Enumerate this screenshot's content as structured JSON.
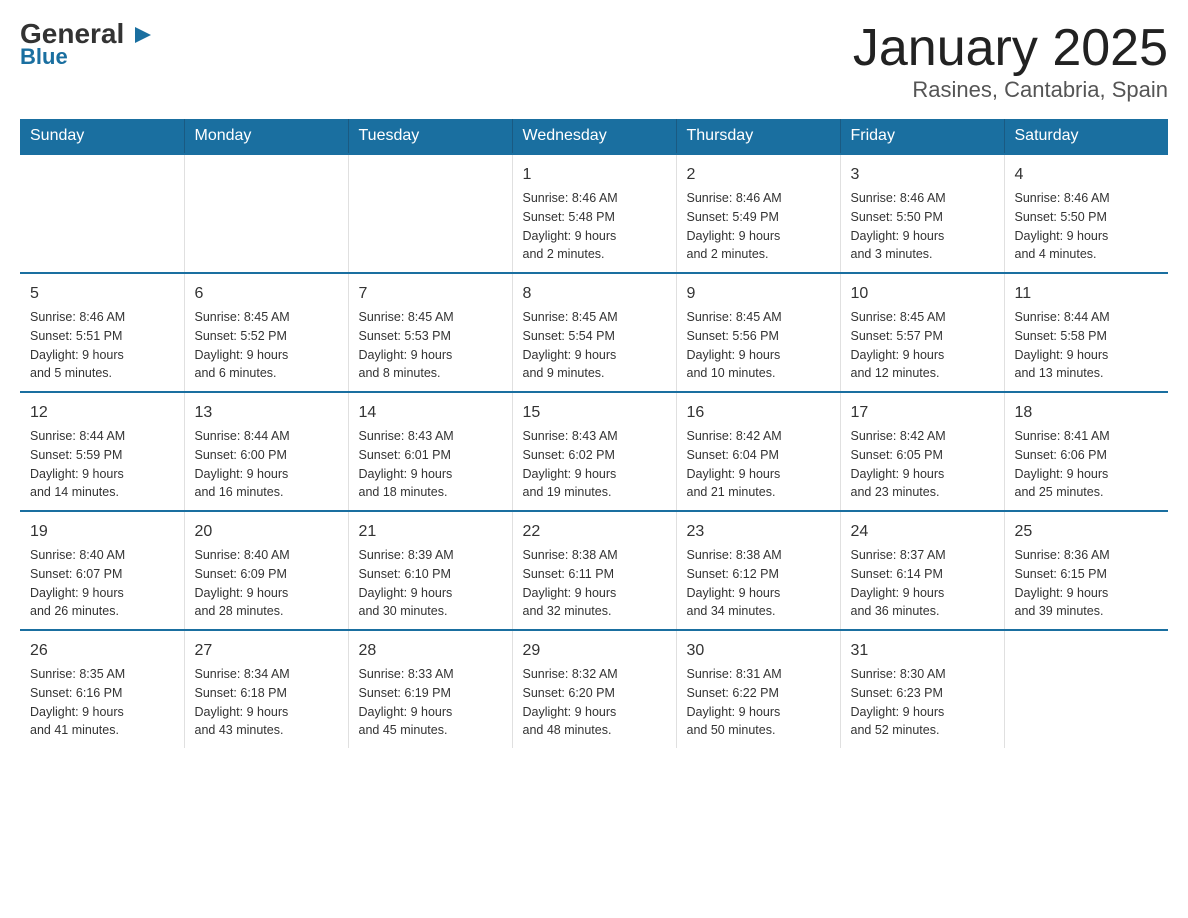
{
  "logo": {
    "line1_regular": "General",
    "line1_arrow": "▶",
    "line2": "Blue"
  },
  "title": "January 2025",
  "location": "Rasines, Cantabria, Spain",
  "days_of_week": [
    "Sunday",
    "Monday",
    "Tuesday",
    "Wednesday",
    "Thursday",
    "Friday",
    "Saturday"
  ],
  "weeks": [
    [
      {
        "day": "",
        "info": ""
      },
      {
        "day": "",
        "info": ""
      },
      {
        "day": "",
        "info": ""
      },
      {
        "day": "1",
        "info": "Sunrise: 8:46 AM\nSunset: 5:48 PM\nDaylight: 9 hours\nand 2 minutes."
      },
      {
        "day": "2",
        "info": "Sunrise: 8:46 AM\nSunset: 5:49 PM\nDaylight: 9 hours\nand 2 minutes."
      },
      {
        "day": "3",
        "info": "Sunrise: 8:46 AM\nSunset: 5:50 PM\nDaylight: 9 hours\nand 3 minutes."
      },
      {
        "day": "4",
        "info": "Sunrise: 8:46 AM\nSunset: 5:50 PM\nDaylight: 9 hours\nand 4 minutes."
      }
    ],
    [
      {
        "day": "5",
        "info": "Sunrise: 8:46 AM\nSunset: 5:51 PM\nDaylight: 9 hours\nand 5 minutes."
      },
      {
        "day": "6",
        "info": "Sunrise: 8:45 AM\nSunset: 5:52 PM\nDaylight: 9 hours\nand 6 minutes."
      },
      {
        "day": "7",
        "info": "Sunrise: 8:45 AM\nSunset: 5:53 PM\nDaylight: 9 hours\nand 8 minutes."
      },
      {
        "day": "8",
        "info": "Sunrise: 8:45 AM\nSunset: 5:54 PM\nDaylight: 9 hours\nand 9 minutes."
      },
      {
        "day": "9",
        "info": "Sunrise: 8:45 AM\nSunset: 5:56 PM\nDaylight: 9 hours\nand 10 minutes."
      },
      {
        "day": "10",
        "info": "Sunrise: 8:45 AM\nSunset: 5:57 PM\nDaylight: 9 hours\nand 12 minutes."
      },
      {
        "day": "11",
        "info": "Sunrise: 8:44 AM\nSunset: 5:58 PM\nDaylight: 9 hours\nand 13 minutes."
      }
    ],
    [
      {
        "day": "12",
        "info": "Sunrise: 8:44 AM\nSunset: 5:59 PM\nDaylight: 9 hours\nand 14 minutes."
      },
      {
        "day": "13",
        "info": "Sunrise: 8:44 AM\nSunset: 6:00 PM\nDaylight: 9 hours\nand 16 minutes."
      },
      {
        "day": "14",
        "info": "Sunrise: 8:43 AM\nSunset: 6:01 PM\nDaylight: 9 hours\nand 18 minutes."
      },
      {
        "day": "15",
        "info": "Sunrise: 8:43 AM\nSunset: 6:02 PM\nDaylight: 9 hours\nand 19 minutes."
      },
      {
        "day": "16",
        "info": "Sunrise: 8:42 AM\nSunset: 6:04 PM\nDaylight: 9 hours\nand 21 minutes."
      },
      {
        "day": "17",
        "info": "Sunrise: 8:42 AM\nSunset: 6:05 PM\nDaylight: 9 hours\nand 23 minutes."
      },
      {
        "day": "18",
        "info": "Sunrise: 8:41 AM\nSunset: 6:06 PM\nDaylight: 9 hours\nand 25 minutes."
      }
    ],
    [
      {
        "day": "19",
        "info": "Sunrise: 8:40 AM\nSunset: 6:07 PM\nDaylight: 9 hours\nand 26 minutes."
      },
      {
        "day": "20",
        "info": "Sunrise: 8:40 AM\nSunset: 6:09 PM\nDaylight: 9 hours\nand 28 minutes."
      },
      {
        "day": "21",
        "info": "Sunrise: 8:39 AM\nSunset: 6:10 PM\nDaylight: 9 hours\nand 30 minutes."
      },
      {
        "day": "22",
        "info": "Sunrise: 8:38 AM\nSunset: 6:11 PM\nDaylight: 9 hours\nand 32 minutes."
      },
      {
        "day": "23",
        "info": "Sunrise: 8:38 AM\nSunset: 6:12 PM\nDaylight: 9 hours\nand 34 minutes."
      },
      {
        "day": "24",
        "info": "Sunrise: 8:37 AM\nSunset: 6:14 PM\nDaylight: 9 hours\nand 36 minutes."
      },
      {
        "day": "25",
        "info": "Sunrise: 8:36 AM\nSunset: 6:15 PM\nDaylight: 9 hours\nand 39 minutes."
      }
    ],
    [
      {
        "day": "26",
        "info": "Sunrise: 8:35 AM\nSunset: 6:16 PM\nDaylight: 9 hours\nand 41 minutes."
      },
      {
        "day": "27",
        "info": "Sunrise: 8:34 AM\nSunset: 6:18 PM\nDaylight: 9 hours\nand 43 minutes."
      },
      {
        "day": "28",
        "info": "Sunrise: 8:33 AM\nSunset: 6:19 PM\nDaylight: 9 hours\nand 45 minutes."
      },
      {
        "day": "29",
        "info": "Sunrise: 8:32 AM\nSunset: 6:20 PM\nDaylight: 9 hours\nand 48 minutes."
      },
      {
        "day": "30",
        "info": "Sunrise: 8:31 AM\nSunset: 6:22 PM\nDaylight: 9 hours\nand 50 minutes."
      },
      {
        "day": "31",
        "info": "Sunrise: 8:30 AM\nSunset: 6:23 PM\nDaylight: 9 hours\nand 52 minutes."
      },
      {
        "day": "",
        "info": ""
      }
    ]
  ]
}
